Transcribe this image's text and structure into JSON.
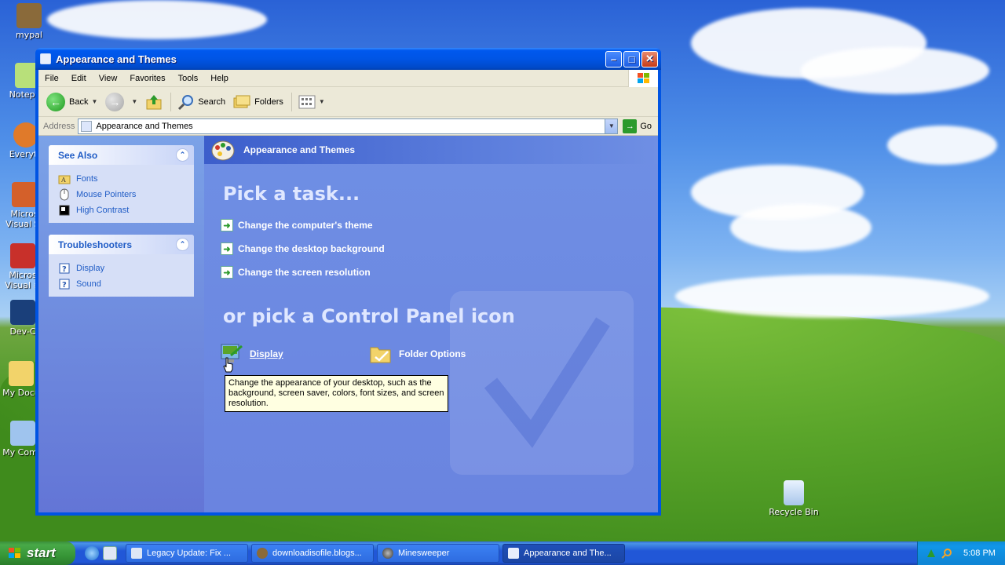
{
  "window": {
    "title": "Appearance and Themes",
    "menu": [
      "File",
      "Edit",
      "View",
      "Favorites",
      "Tools",
      "Help"
    ],
    "toolbar": {
      "back": "Back",
      "search": "Search",
      "folders": "Folders"
    },
    "address": {
      "label": "Address",
      "value": "Appearance and Themes",
      "go": "Go"
    }
  },
  "left_pane": {
    "see_also": {
      "title": "See Also",
      "items": [
        {
          "label": "Fonts",
          "icon": "folder-icon"
        },
        {
          "label": "Mouse Pointers",
          "icon": "mouse-icon"
        },
        {
          "label": "High Contrast",
          "icon": "contrast-icon"
        }
      ]
    },
    "troubleshooters": {
      "title": "Troubleshooters",
      "items": [
        {
          "label": "Display",
          "icon": "help-icon"
        },
        {
          "label": "Sound",
          "icon": "help-icon"
        }
      ]
    }
  },
  "main": {
    "header": "Appearance and Themes",
    "pick_task": "Pick a task...",
    "tasks": [
      "Change the computer's theme",
      "Change the desktop background",
      "Change the screen resolution"
    ],
    "pick_icon": "or pick a Control Panel icon",
    "icons": [
      "Display",
      "Folder Options"
    ],
    "tooltip": "Change the appearance of your desktop, such as the background, screen saver, colors, font sizes, and screen resolution."
  },
  "desktop": {
    "icons": [
      "mypal",
      "Notepad",
      "Everyth",
      "Micros Visual St",
      "Micros Visual #",
      "Dev-C",
      "My Docu",
      "My Comp"
    ],
    "recycle_bin": "Recycle Bin"
  },
  "taskbar": {
    "start": "start",
    "tasks": [
      "Legacy Update: Fix ...",
      "downloadisofile.blogs...",
      "Minesweeper",
      "Appearance and The..."
    ],
    "clock": "5:08 PM"
  },
  "colors": {
    "titlebar": "#0058ee",
    "taskpane": "#6375d6",
    "link": "#215dc6",
    "taskbar": "#2157d7",
    "start": "#379637"
  }
}
